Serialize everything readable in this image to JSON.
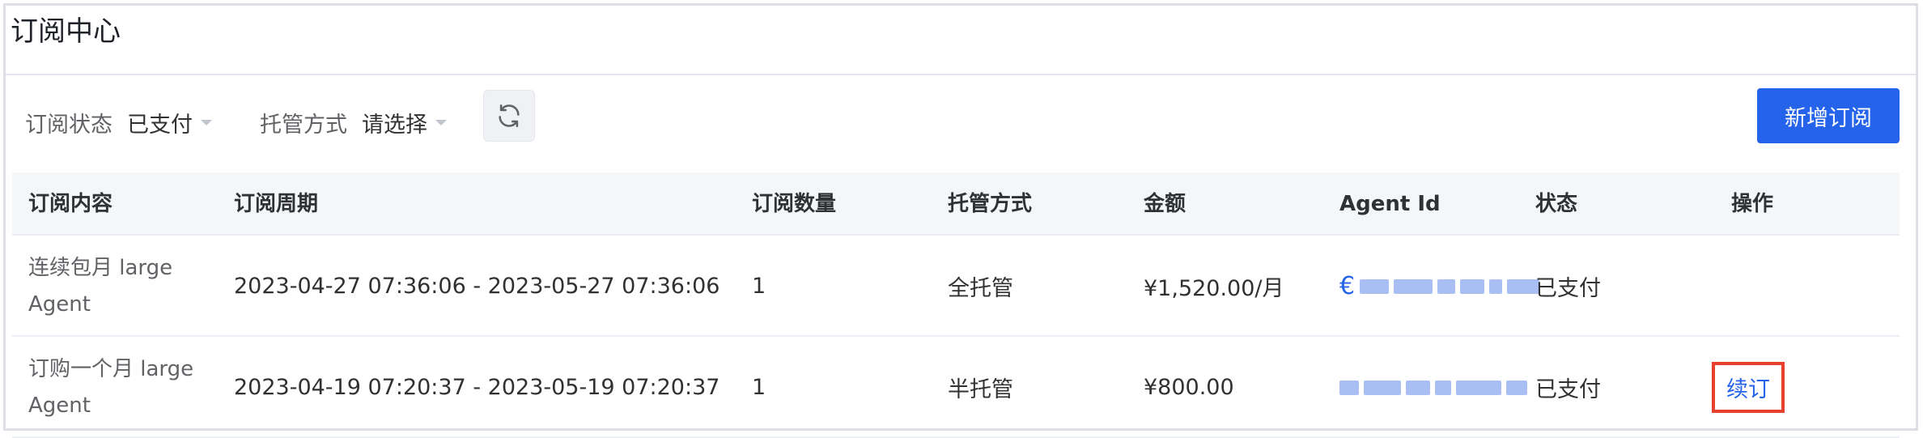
{
  "page": {
    "title": "订阅中心"
  },
  "filters": {
    "status_label": "订阅状态",
    "status_value": "已支付",
    "hosting_label": "托管方式",
    "hosting_value": "请选择",
    "refresh_icon": "refresh-icon"
  },
  "toolbar": {
    "add_label": "新增订阅"
  },
  "colors": {
    "primary": "#2563eb",
    "highlight_border": "#e8402f"
  },
  "table": {
    "columns": [
      "订阅内容",
      "订阅周期",
      "订阅数量",
      "托管方式",
      "金额",
      "Agent Id",
      "状态",
      "操作"
    ],
    "rows": [
      {
        "content": "连续包月 large Agent",
        "period": "2023-04-27 07:36:06 - 2023-05-27 07:36:06",
        "quantity": "1",
        "hosting": "全托管",
        "amount": "¥1,520.00/月",
        "agent_prefix": "€",
        "status": "已支付",
        "action": ""
      },
      {
        "content": "订购一个月 large Agent",
        "period": "2023-04-19 07:20:37 - 2023-05-19 07:20:37",
        "quantity": "1",
        "hosting": "半托管",
        "amount": "¥800.00",
        "agent_prefix": "",
        "status": "已支付",
        "action": "续订"
      }
    ]
  }
}
